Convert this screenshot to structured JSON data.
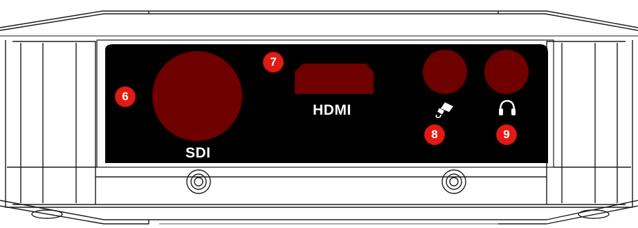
{
  "device": {
    "labels": {
      "sdi": "SDI",
      "hdmi": "HDMI"
    },
    "callouts": [
      {
        "id": "sdi",
        "number": "6"
      },
      {
        "id": "hdmi",
        "number": "7"
      },
      {
        "id": "mic",
        "number": "8"
      },
      {
        "id": "headphone",
        "number": "9"
      }
    ],
    "icons": {
      "mic": "microphone-icon",
      "headphone": "headphones-icon"
    },
    "colors": {
      "panel": "#000000",
      "port": "#6e0000",
      "callout": "#e11b14",
      "outline": "#1a1a1a",
      "body": "#ffffff"
    }
  }
}
